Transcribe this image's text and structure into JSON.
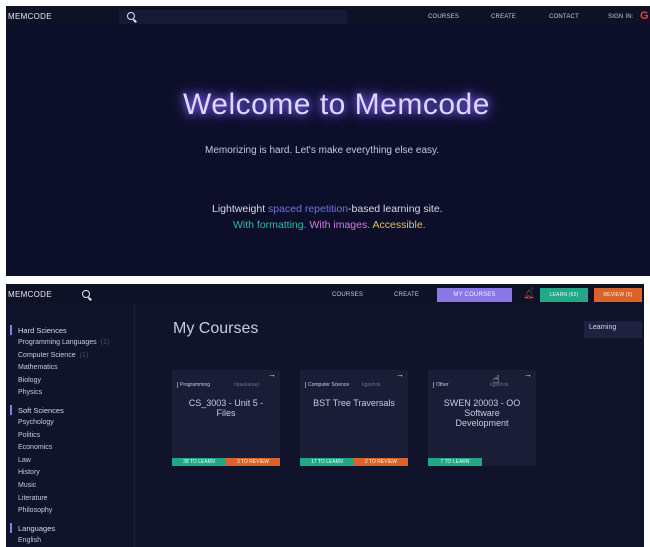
{
  "top": {
    "logo": "MEMCODE",
    "nav": {
      "courses": "COURSES",
      "create": "CREATE",
      "contact": "CONTACT",
      "signin": "SIGN IN:",
      "google": "G"
    },
    "hero": {
      "title": "Welcome to Memcode",
      "subtitle": "Memorizing is hard. Let's make everything else easy.",
      "line1_a": "Lightweight ",
      "line1_b": "spaced repetition",
      "line1_c": "-based learning site.",
      "line2_a": "With formatting.",
      "line2_b": " With images.",
      "line2_c": " Accessible."
    }
  },
  "bottom": {
    "logo": "MEMCODE",
    "nav": {
      "courses": "COURSES",
      "create": "CREATE",
      "my_courses": "MY COURSES",
      "bell_badge": "0",
      "learn": "LEARN (62)",
      "review": "REVIEW (5)"
    },
    "page_title": "My Courses",
    "filter": "Learning",
    "sidebar": [
      {
        "label": "Hard Sciences",
        "head": true
      },
      {
        "label": "Programming Languages",
        "count": "(1)"
      },
      {
        "label": "Computer Science",
        "count": "(1)"
      },
      {
        "label": "Mathematics"
      },
      {
        "label": "Biology"
      },
      {
        "label": "Physics"
      },
      {
        "label": "Soft Sciences",
        "head": true
      },
      {
        "label": "Psychology"
      },
      {
        "label": "Politics"
      },
      {
        "label": "Economics"
      },
      {
        "label": "Law"
      },
      {
        "label": "History"
      },
      {
        "label": "Music"
      },
      {
        "label": "Literature"
      },
      {
        "label": "Philosophy"
      },
      {
        "label": "Languages",
        "head": true
      },
      {
        "label": "English"
      }
    ],
    "cards": [
      {
        "category": "Programming",
        "user": "ripaekanayi",
        "title": "CS_3003 - Unit 5 - Files",
        "learn": "38 TO LEARN",
        "review": "3 TO REVIEW"
      },
      {
        "category": "Computer Science",
        "user": "kgashok",
        "title": "BST Tree Traversals",
        "learn": "17 TO LEARN",
        "review": "2 TO REVIEW"
      },
      {
        "category": "Other",
        "user": "kgashok",
        "title": "SWEN 20003 - OO Software Development",
        "learn": "7 TO LEARN",
        "review": ""
      }
    ]
  }
}
